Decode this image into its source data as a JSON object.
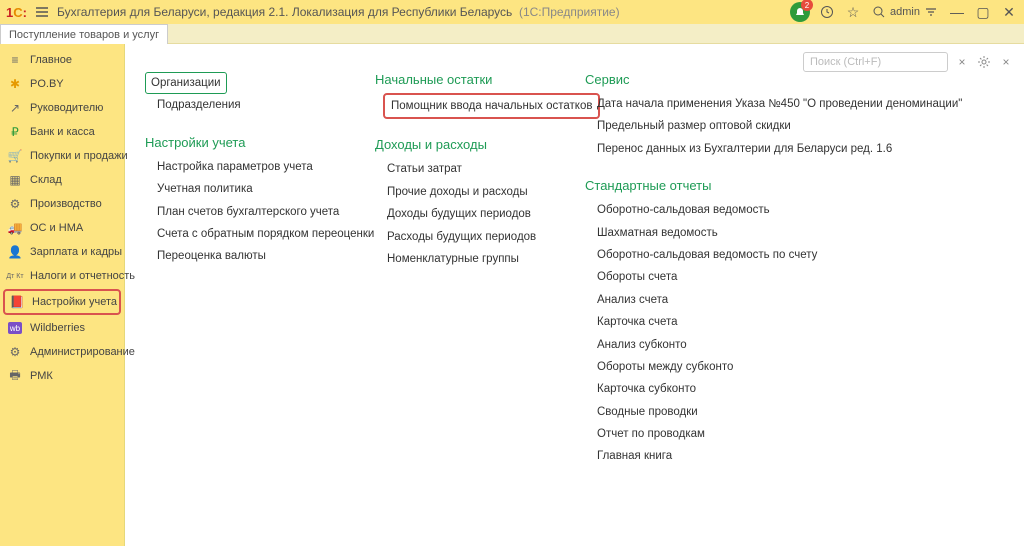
{
  "titlebar": {
    "title_main": "Бухгалтерия для Беларуси, редакция 2.1. Локализация для Республики Беларусь",
    "title_sub": "(1С:Предприятие)",
    "notif_count": "2",
    "user": "admin"
  },
  "tab": {
    "label": "Поступление товаров и услуг"
  },
  "search": {
    "placeholder": "Поиск (Ctrl+F)",
    "clear": "×"
  },
  "sidebar": [
    {
      "label": "Главное",
      "icon": "≡"
    },
    {
      "label": "PO.BY",
      "icon": "✱"
    },
    {
      "label": "Руководителю",
      "icon": "↗"
    },
    {
      "label": "Банк и касса",
      "icon": "₽"
    },
    {
      "label": "Покупки и продажи",
      "icon": "🛒"
    },
    {
      "label": "Склад",
      "icon": "▦"
    },
    {
      "label": "Производство",
      "icon": "⚙"
    },
    {
      "label": "ОС и НМА",
      "icon": "🚚"
    },
    {
      "label": "Зарплата и кадры",
      "icon": "👤"
    },
    {
      "label": "Налоги и отчетность",
      "icon": "Дт Кт"
    },
    {
      "label": "Настройки учета",
      "icon": "📕",
      "selected": true
    },
    {
      "label": "Wildberries",
      "icon": "wb"
    },
    {
      "label": "Администрирование",
      "icon": "⚙"
    },
    {
      "label": "РМК",
      "icon": "🖶"
    }
  ],
  "col1": {
    "group1": {
      "items": [
        "Организации",
        "Подразделения"
      ]
    },
    "group2": {
      "head": "Настройки учета",
      "items": [
        "Настройка параметров учета",
        "Учетная политика",
        "План счетов бухгалтерского учета",
        "Счета с обратным порядком переоценки",
        "Переоценка валюты"
      ]
    }
  },
  "col2": {
    "group1": {
      "head": "Начальные остатки",
      "items": [
        "Помощник ввода начальных остатков"
      ]
    },
    "group2": {
      "head": "Доходы и расходы",
      "items": [
        "Статьи затрат",
        "Прочие доходы и расходы",
        "Доходы будущих периодов",
        "Расходы будущих периодов",
        "Номенклатурные группы"
      ]
    }
  },
  "col3": {
    "group1": {
      "head": "Сервис",
      "items": [
        "Дата начала применения Указа №450 \"О проведении деноминации\"",
        "Предельный размер оптовой скидки",
        "Перенос данных из Бухгалтерии для Беларуси ред. 1.6"
      ]
    },
    "group2": {
      "head": "Стандартные отчеты",
      "items": [
        "Оборотно-сальдовая ведомость",
        "Шахматная ведомость",
        "Оборотно-сальдовая ведомость по счету",
        "Обороты счета",
        "Анализ счета",
        "Карточка счета",
        "Анализ субконто",
        "Обороты между субконто",
        "Карточка субконто",
        "Сводные проводки",
        "Отчет по проводкам",
        "Главная книга"
      ]
    }
  }
}
